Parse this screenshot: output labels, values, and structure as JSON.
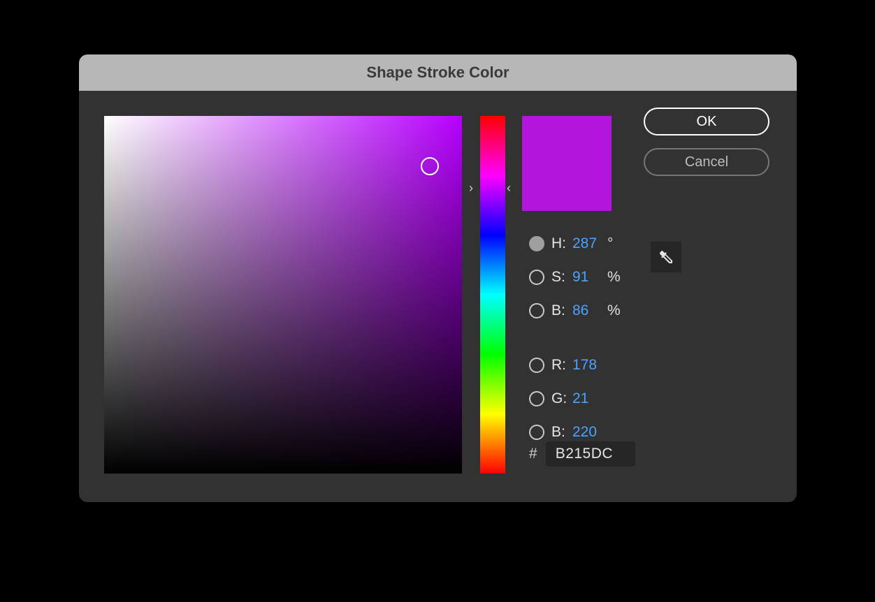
{
  "dialog": {
    "title": "Shape Stroke Color",
    "ok_label": "OK",
    "cancel_label": "Cancel"
  },
  "color": {
    "hue_deg": 287,
    "swatch_hex": "#B215DC",
    "sb_field_base": "#B700FF",
    "cursor": {
      "saturation_pct": 91,
      "brightness_pct": 86
    }
  },
  "hsb": {
    "h": {
      "label": "H:",
      "value": "287",
      "unit": "°",
      "selected": true
    },
    "s": {
      "label": "S:",
      "value": "91",
      "unit": "%"
    },
    "b": {
      "label": "B:",
      "value": "86",
      "unit": "%"
    }
  },
  "rgb": {
    "r": {
      "label": "R:",
      "value": "178"
    },
    "g": {
      "label": "G:",
      "value": "21"
    },
    "b": {
      "label": "B:",
      "value": "220"
    }
  },
  "hex": {
    "hash": "#",
    "value": "B215DC"
  },
  "hue_arrows": {
    "left_glyph": "›",
    "right_glyph": "‹"
  }
}
